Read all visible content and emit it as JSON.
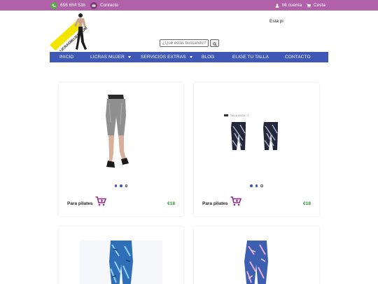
{
  "topbar": {
    "phone": "656 654 538",
    "contact": "Contacto",
    "account": "Mi cuenta",
    "cart": "Cesta",
    "icons": {
      "phone": "phone-icon",
      "mail": "mail-icon",
      "user": "user-icon",
      "cart": "cart-icon"
    }
  },
  "header": {
    "logo_text": "LICRASMUJER.COM",
    "language": "Esta pi",
    "search_placeholder": "¿Qué estás buscando?"
  },
  "nav": {
    "items": [
      {
        "label": "INICIO"
      },
      {
        "label": "LICRAS MUJER"
      },
      {
        "label": "SERVICIOS EXTRAS"
      },
      {
        "label": "BLOG"
      },
      {
        "label": "ELIGE TU TALLA"
      },
      {
        "label": "CONTACTO"
      }
    ]
  },
  "products": [
    {
      "title": "Para pilates",
      "price": "€18"
    },
    {
      "title": "Para pilates",
      "price": "€18",
      "image_caption": "TALLA UNICA · 2"
    },
    {
      "title": ""
    },
    {
      "title": ""
    }
  ],
  "colors": {
    "topbar": "#b061a8",
    "nav": "#3f58b5",
    "price": "#2e8b2e",
    "cart_icon": "#8e2a8a"
  }
}
